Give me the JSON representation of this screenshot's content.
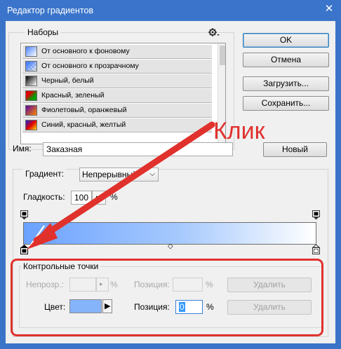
{
  "window": {
    "title": "Редактор градиентов",
    "close_glyph": "✕"
  },
  "presets": {
    "group_label": "Наборы",
    "menu_icon": "gear-icon",
    "items": [
      {
        "label": "От основного к фоновому"
      },
      {
        "label": "От основного к прозрачному"
      },
      {
        "label": "Черный, белый"
      },
      {
        "label": "Красный, зеленый"
      },
      {
        "label": "Фиолетовый, оранжевый"
      },
      {
        "label": "Синий, красный, желтый"
      }
    ]
  },
  "buttons": {
    "ok": "OK",
    "cancel": "Отмена",
    "load": "Загрузить...",
    "save": "Сохранить...",
    "new": "Новый"
  },
  "name": {
    "label": "Имя:",
    "value": "Заказная"
  },
  "gradient": {
    "type_label": "Градиент:",
    "type_value": "Непрерывный",
    "smoothness_label": "Гладкость:",
    "smoothness_value": "100",
    "smoothness_unit": "%"
  },
  "stops": {
    "group_label": "Контрольные точки",
    "opacity_label": "Непрозр.:",
    "opacity_unit": "%",
    "opacity_position_label": "Позиция:",
    "opacity_position_unit": "%",
    "opacity_delete": "Удалить",
    "color_label": "Цвет:",
    "color_value": "#85b4fb",
    "color_position_label": "Позиция:",
    "color_position_value": "0",
    "color_position_unit": "%",
    "color_delete": "Удалить"
  },
  "annotation": {
    "text": "Клик",
    "color": "#e0312d"
  },
  "colors": {
    "title_bar": "#3b75cb",
    "gradient_start": "#6ba2ff",
    "gradient_end": "#ffffff",
    "highlight": "#e0312d"
  }
}
